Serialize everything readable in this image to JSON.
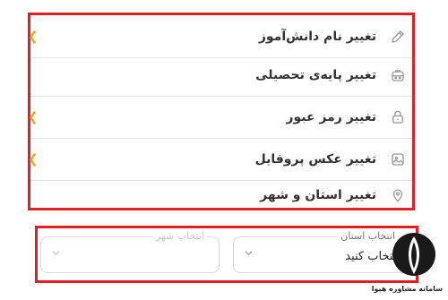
{
  "menu": {
    "items": [
      {
        "label": "تغییر نام دانش‌آموز",
        "icon": "pencil-icon",
        "chevron": true
      },
      {
        "label": "تغییر پایه‌ی تحصیلی",
        "icon": "school-bag-icon",
        "chevron": false
      },
      {
        "label": "تغییر رمز عبور",
        "icon": "lock-icon",
        "chevron": true
      },
      {
        "label": "تغییر عکس پروفایل",
        "icon": "image-icon",
        "chevron": true
      },
      {
        "label": "تغییر استان و شهر",
        "icon": "location-pin-icon",
        "chevron": false
      }
    ]
  },
  "location": {
    "province_label": "انتخاب استان",
    "province_value": "انتخاب کنید",
    "city_label": "انتخاب شهر",
    "city_value": ""
  },
  "watermark": {
    "text": "سامانه مشاوره هپوا"
  },
  "colors": {
    "highlight_border": "#e41e24",
    "chevron": "#f5a623",
    "icon": "#9a9a9a"
  }
}
